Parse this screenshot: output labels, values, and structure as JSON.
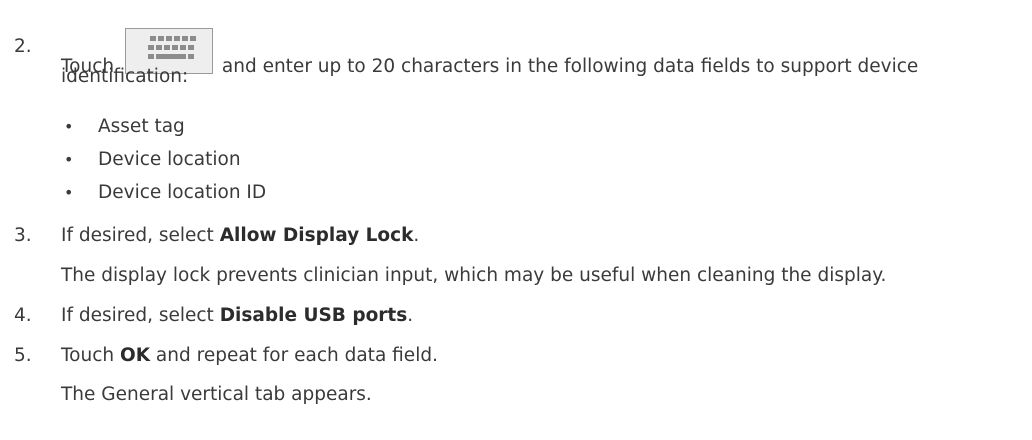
{
  "steps": [
    {
      "number": "2.",
      "text_before_icon": "Touch",
      "icon": "keyboard-icon",
      "text_after_icon": "and enter up to 20 characters in the following data fields to support device",
      "text_line2": "identification:",
      "bullets": [
        "Asset tag",
        "Device location",
        "Device location ID"
      ]
    },
    {
      "number": "3.",
      "text_before": "If desired, select ",
      "bold": "Allow Display Lock",
      "text_after": ".",
      "note": "The display lock prevents clinician input, which may be useful when cleaning the display."
    },
    {
      "number": "4.",
      "text_before": "If desired, select ",
      "bold": "Disable USB ports",
      "text_after": "."
    },
    {
      "number": "5.",
      "text_before": "Touch ",
      "bold": "OK",
      "text_after": " and repeat for each data field.",
      "note": "The General vertical tab appears."
    }
  ],
  "colors": {
    "text": "#3a3a3a",
    "icon_border": "#9a9a9a",
    "icon_keys": "#8c8c8c",
    "icon_bg": "#eeeeee"
  },
  "bullet_glyph": "•"
}
